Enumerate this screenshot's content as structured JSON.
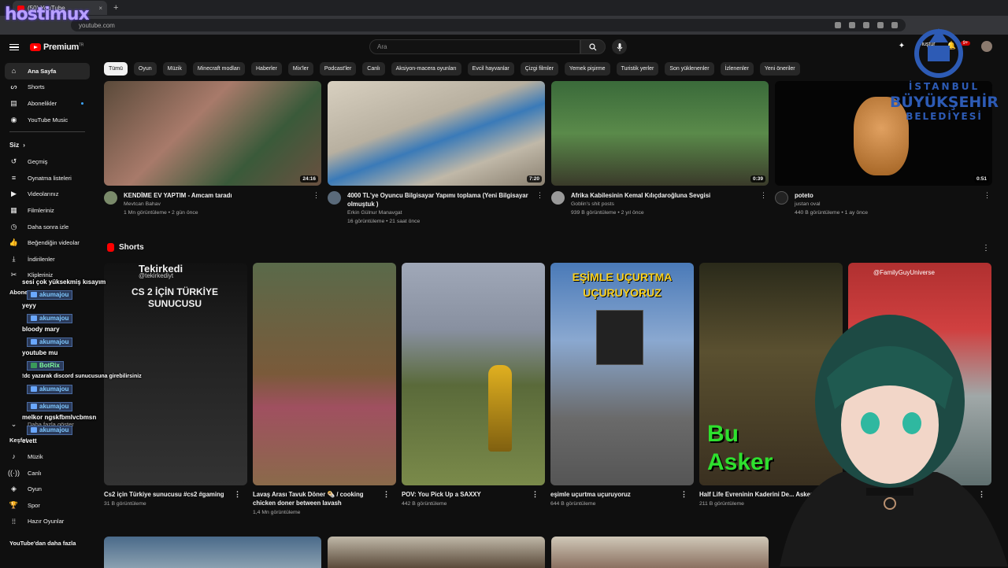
{
  "browser": {
    "tab_title": "(50) YouTube",
    "tab_close": "×",
    "new_tab": "+",
    "url": "youtube.com",
    "overlay_logo": "hostimux"
  },
  "masthead": {
    "logo_text": "Premium",
    "logo_sup": "TR",
    "search_placeholder": "Ara",
    "notification_count": "9+",
    "create_label": "Oluştur"
  },
  "sidebar": {
    "main": [
      {
        "label": "Ana Sayfa",
        "icon": "home-icon",
        "active": true
      },
      {
        "label": "Shorts",
        "icon": "shorts-icon"
      },
      {
        "label": "Abonelikler",
        "icon": "subscriptions-icon"
      },
      {
        "label": "YouTube Music",
        "icon": "music-icon"
      }
    ],
    "you_header": "Siz",
    "you": [
      {
        "label": "Geçmiş",
        "icon": "history-icon"
      },
      {
        "label": "Oynatma listeleri",
        "icon": "playlist-icon"
      },
      {
        "label": "Videolarınız",
        "icon": "your-videos-icon"
      },
      {
        "label": "Filmleriniz",
        "icon": "movies-icon"
      },
      {
        "label": "Daha sonra izle",
        "icon": "watch-later-icon"
      },
      {
        "label": "Beğendiğin videolar",
        "icon": "like-icon"
      },
      {
        "label": "İndirilenler",
        "icon": "download-icon"
      },
      {
        "label": "Klipleriniz",
        "icon": "clips-icon"
      }
    ],
    "subs_header": "Abone",
    "more_label": "Daha fazla göster",
    "explore_header": "Keşfet",
    "explore": [
      {
        "label": "Müzik",
        "icon": "music-note-icon"
      },
      {
        "label": "Canlı",
        "icon": "live-icon"
      },
      {
        "label": "Oyun",
        "icon": "gaming-icon"
      },
      {
        "label": "Spor",
        "icon": "trophy-icon"
      },
      {
        "label": "Hazır Oyunlar",
        "icon": "playables-icon"
      }
    ],
    "footer": "YouTube'dan daha fazla"
  },
  "chips": [
    "Tümü",
    "Oyun",
    "Müzik",
    "Minecraft modları",
    "Haberler",
    "Mix'ler",
    "Podcast'ler",
    "Canlı",
    "Aksiyon-macera oyunları",
    "Evcil hayvanlar",
    "Çizgi filmler",
    "Yemek pişirme",
    "Turistik yerler",
    "Son yüklenenler",
    "İzlenenler",
    "Yeni öneriler"
  ],
  "videos": [
    {
      "title": "KENDİME EV YAPTIM - Amcam taradı",
      "channel": "Mevtcan Bahav",
      "stats": "1 Mn görüntüleme • 2 gün önce",
      "duration": "24:16"
    },
    {
      "title": "4000 TL'ye Oyuncu Bilgisayar Yapımı toplama (Yeni Bilgisayar olmuştuk )",
      "channel": "Erkin Gülnur Manavgat",
      "stats": "16 görüntüleme • 21 saat önce",
      "duration": "7:20"
    },
    {
      "title": "Afrika Kabilesinin Kemal Kılıçdaroğluna Sevgisi",
      "channel": "Goblin's shit posts",
      "stats": "939 B görüntüleme • 2 yıl önce",
      "duration": "0:39"
    },
    {
      "title": "poteto",
      "channel": "justan oval",
      "stats": "440 B görüntüleme • 1 ay önce",
      "duration": "0:51"
    }
  ],
  "shorts_header": "Shorts",
  "shorts": [
    {
      "title": "Cs2 için Türkiye sunucusu #cs2 #gaming",
      "views": "31 B görüntüleme",
      "overlay_channel": "Tekirkedi",
      "overlay_handle": "@tekirkediyt",
      "overlay_text": "CS 2 İÇİN TÜRKİYE SUNUCUSU"
    },
    {
      "title": "Lavaş Arası Tavuk Döner 🌯 / cooking chicken doner between lavash",
      "views": "1,4 Mn görüntüleme"
    },
    {
      "title": "POV: You Pick Up a SAXXY",
      "views": "442 B görüntüleme"
    },
    {
      "title": "eşimle uçurtma uçuruyoruz",
      "views": "644 B görüntüleme",
      "overlay_text": "EŞİMLE UÇURTMA UÇURUYORUZ"
    },
    {
      "title": "Half Life Evreninin Kaderini De... Askerler",
      "views": "211 B görüntüleme",
      "overlay_text": "Bu Asker"
    },
    {
      "title": "",
      "views": "",
      "overlay_handle": "@FamilyGuyUniverse"
    }
  ],
  "chat": [
    {
      "type": "msg",
      "text": "sesi çok yüksekmiş kısayım"
    },
    {
      "type": "user",
      "text": "akumajou"
    },
    {
      "type": "msg",
      "text": "yeyy"
    },
    {
      "type": "user",
      "text": "akumajou"
    },
    {
      "type": "msg",
      "text": "bloody mary"
    },
    {
      "type": "user",
      "text": "akumajou"
    },
    {
      "type": "msg",
      "text": "youtube mu"
    },
    {
      "type": "user",
      "text": "BotRix"
    },
    {
      "type": "msg",
      "text": "!dc yazarak discord sunucusuna girebilirsiniz"
    },
    {
      "type": "user",
      "text": "akumajou"
    },
    {
      "type": "msg",
      "text": ""
    },
    {
      "type": "user",
      "text": "akumajou"
    },
    {
      "type": "msg",
      "text": "melkor ngskfbmlvcbmsn"
    },
    {
      "type": "user",
      "text": "akumajou"
    },
    {
      "type": "msg",
      "text": "evett"
    }
  ],
  "ibb_logo": {
    "line1": "İSTANBUL",
    "line2": "BÜYÜKŞEHİR",
    "line3": "BELEDİYESİ"
  }
}
